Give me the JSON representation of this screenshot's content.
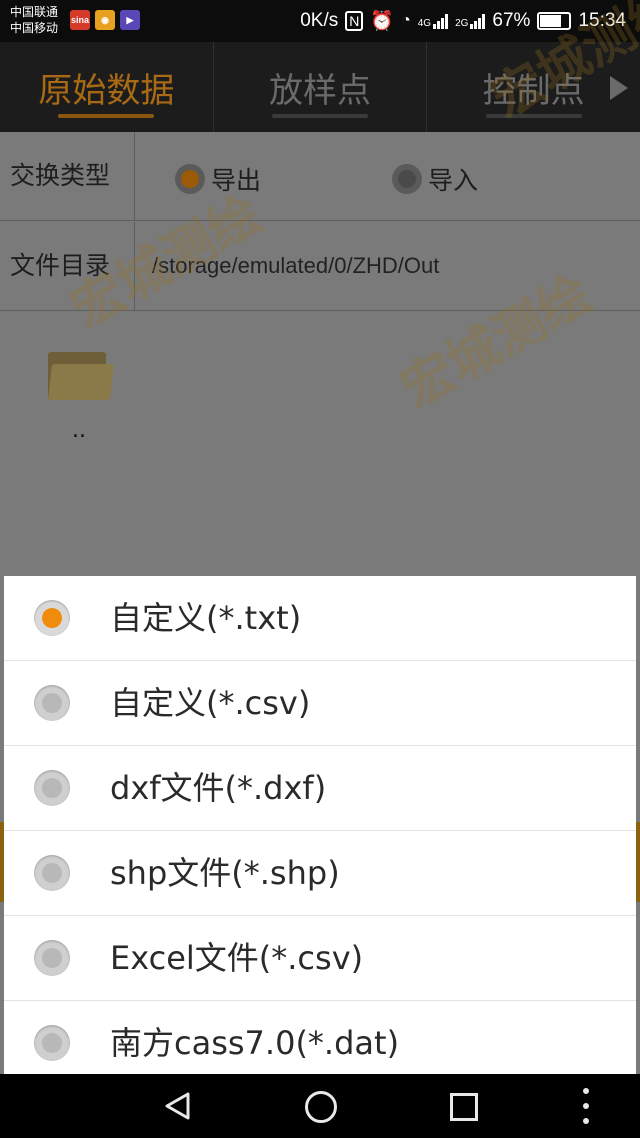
{
  "status_bar": {
    "carrier_1": "中国联通",
    "carrier_2": "中国移动",
    "app_icons": [
      "sina-news-icon",
      "weibo-icon",
      "video-app-icon"
    ],
    "net_speed": "0K/s",
    "nfc": "N",
    "net_type_1": "4G",
    "net_type_2": "2G",
    "battery": "67%",
    "battery_level": 0.67,
    "time": "15:34"
  },
  "tabs": [
    {
      "label": "原始数据",
      "active": true
    },
    {
      "label": "放样点",
      "active": false
    },
    {
      "label": "控制点",
      "active": false
    }
  ],
  "form": {
    "exchange_type_label": "交换类型",
    "options": [
      {
        "label": "导出",
        "selected": true
      },
      {
        "label": "导入",
        "selected": false
      }
    ],
    "dir_label": "文件目录",
    "dir_value": "/storage/emulated/0/ZHD/Out"
  },
  "file_list": {
    "items": [
      {
        "name": "..",
        "icon": "folder-icon"
      }
    ]
  },
  "watermark": "宏城测绘",
  "format_dialog": {
    "items": [
      {
        "label": "自定义(*.txt)",
        "selected": true
      },
      {
        "label": "自定义(*.csv)",
        "selected": false
      },
      {
        "label": "dxf文件(*.dxf)",
        "selected": false
      },
      {
        "label": "shp文件(*.shp)",
        "selected": false
      },
      {
        "label": "Excel文件(*.csv)",
        "selected": false
      },
      {
        "label": "南方cass7.0(*.dat)",
        "selected": false
      }
    ]
  },
  "colors": {
    "accent": "#f08c0c",
    "active_tab": "#a86a14",
    "status_bar": "#0c0c0c"
  },
  "nav_bar": [
    "back-icon",
    "home-icon",
    "recent-apps-icon",
    "menu-icon"
  ]
}
